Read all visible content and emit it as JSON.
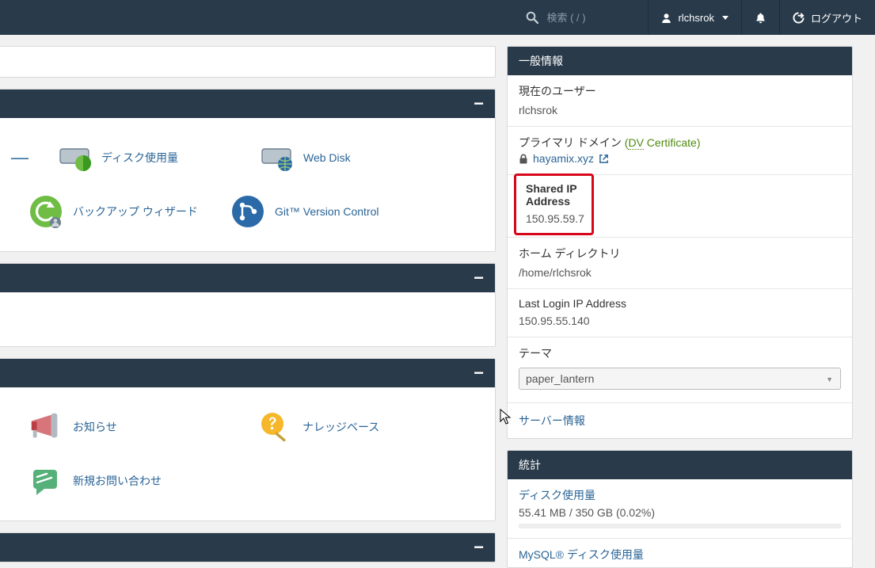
{
  "topbar": {
    "search_placeholder": "検索 ( / )",
    "username": "rlchsrok",
    "logout_label": "ログアウト"
  },
  "main": {
    "files": {
      "items": [
        {
          "id": "dash",
          "label": "—",
          "kind": "dash"
        },
        {
          "id": "disk-usage",
          "label": "ディスク使用量",
          "icon": "disk-usage-icon"
        },
        {
          "id": "web-disk",
          "label": "Web Disk",
          "icon": "web-disk-icon"
        },
        {
          "id": "backup-wizard",
          "label": "バックアップ ウィザード",
          "icon": "backup-wizard-icon"
        },
        {
          "id": "git",
          "label": "Git™ Version Control",
          "icon": "git-icon"
        }
      ]
    },
    "support": {
      "items": [
        {
          "id": "news",
          "label": "お知らせ",
          "icon": "news-icon"
        },
        {
          "id": "kb",
          "label": "ナレッジベース",
          "icon": "kb-icon"
        },
        {
          "id": "contact",
          "label": "新規お問い合わせ",
          "icon": "contact-icon"
        }
      ]
    }
  },
  "side": {
    "general": {
      "title": "一般情報",
      "current_user_label": "現在のユーザー",
      "current_user_value": "rlchsrok",
      "primary_domain_label": "プライマリ ドメイン",
      "dv_cert_label": "DV",
      "dv_cert_suffix": " Certificate)",
      "domain_value": "hayamix.xyz",
      "shared_ip_label": "Shared IP Address",
      "shared_ip_value": "150.95.59.7",
      "home_dir_label": "ホーム ディレクトリ",
      "home_dir_value": "/home/rlchsrok",
      "last_login_label": "Last Login IP Address",
      "last_login_value": "150.95.55.140",
      "theme_label": "テーマ",
      "theme_value": "paper_lantern",
      "server_info_label": "サーバー情報"
    },
    "stats": {
      "title": "統計",
      "disk_usage_label": "ディスク使用量",
      "disk_usage_value": "55.41 MB / 350 GB   (0.02%)",
      "mysql_label": "MySQL® ディスク使用量"
    }
  }
}
